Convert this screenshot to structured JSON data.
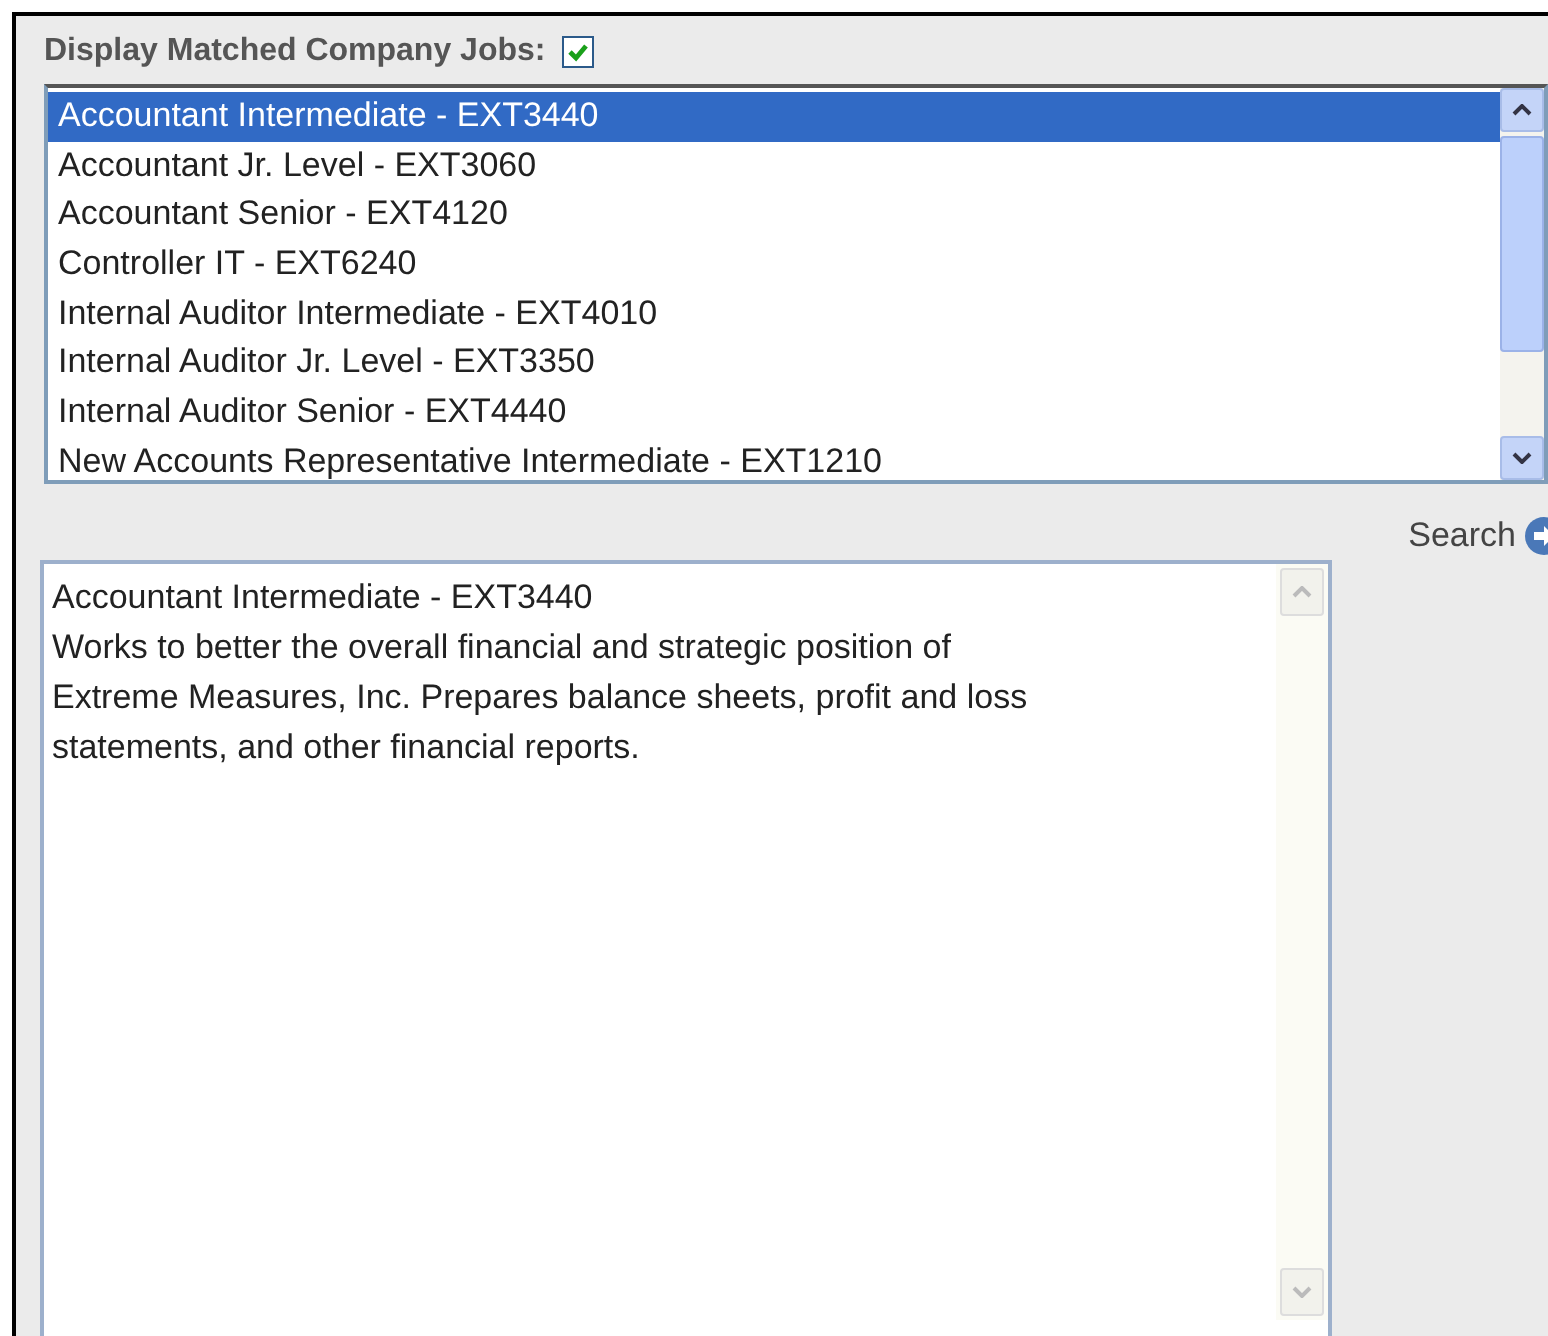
{
  "filter": {
    "label": "Display Matched Company Jobs:",
    "checked": true
  },
  "jobs": [
    {
      "label": "Accountant Intermediate - EXT3440",
      "selected": true
    },
    {
      "label": "Accountant Jr. Level - EXT3060",
      "selected": false
    },
    {
      "label": "Accountant Senior - EXT4120",
      "selected": false
    },
    {
      "label": "Controller IT - EXT6240",
      "selected": false
    },
    {
      "label": "Internal Auditor Intermediate - EXT4010",
      "selected": false
    },
    {
      "label": "Internal Auditor Jr. Level - EXT3350",
      "selected": false
    },
    {
      "label": "Internal Auditor Senior - EXT4440",
      "selected": false
    },
    {
      "label": "New Accounts Representative Intermediate - EXT1210",
      "selected": false
    }
  ],
  "search_button": {
    "label": "Search"
  },
  "description": {
    "lines": [
      "Accountant Intermediate - EXT3440",
      "Works to better the overall financial and strategic position of",
      "Extreme Measures, Inc. Prepares balance sheets, profit and loss",
      "statements, and other financial reports."
    ]
  }
}
